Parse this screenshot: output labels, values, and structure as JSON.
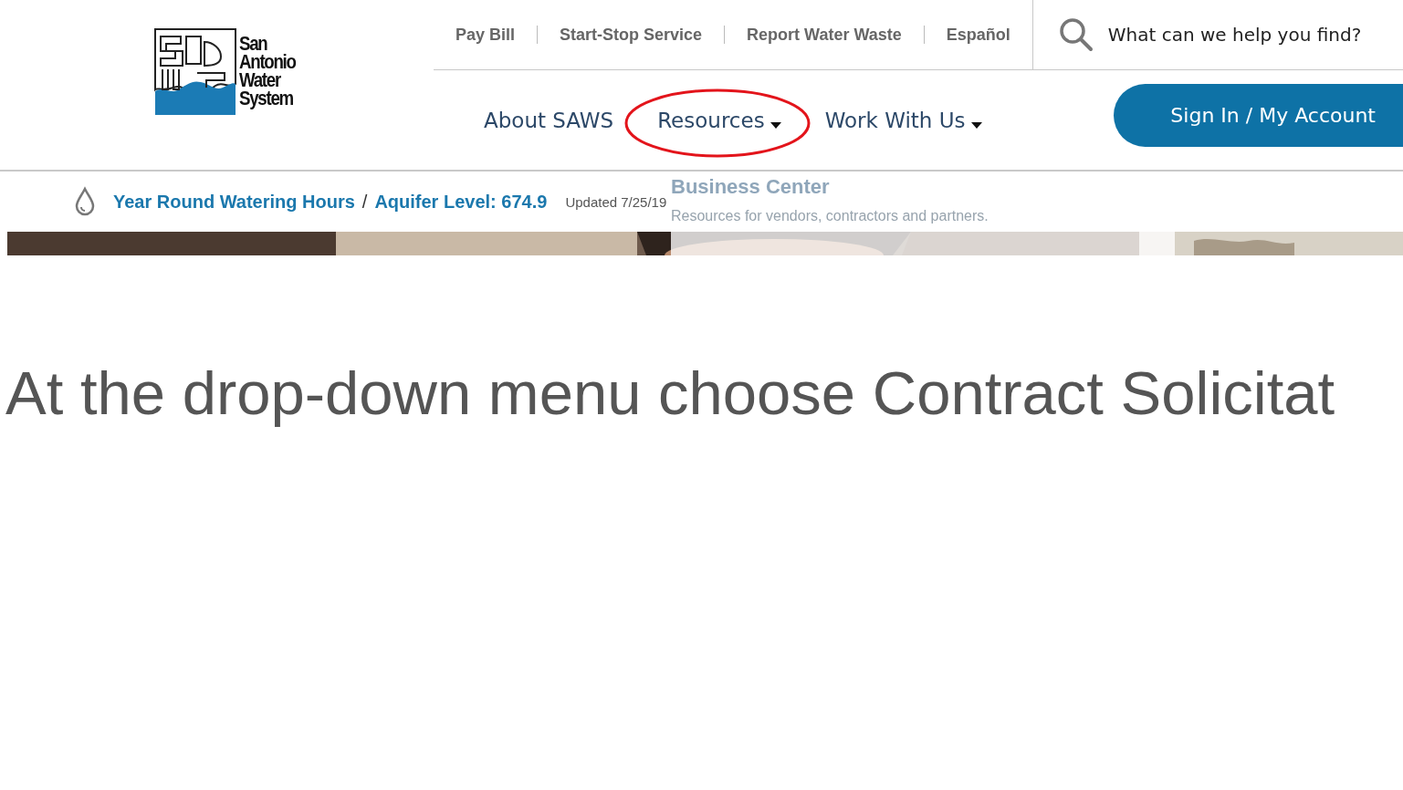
{
  "logo": {
    "lines": [
      "San",
      "Antonio",
      "Water",
      "System"
    ]
  },
  "utility_links": [
    "Pay Bill",
    "Start-Stop Service",
    "Report Water Waste",
    "Español"
  ],
  "search": {
    "placeholder": "What can we help you find?"
  },
  "main_nav": [
    {
      "label": "About SAWS",
      "has_dropdown": false,
      "highlighted": false
    },
    {
      "label": "Resources",
      "has_dropdown": true,
      "highlighted": true
    },
    {
      "label": "Work With Us",
      "has_dropdown": true,
      "highlighted": false
    }
  ],
  "account_button": "Sign In / My Account",
  "info_bar": {
    "watering_link": "Year Round Watering Hours",
    "separator": "/",
    "aquifer_link": "Aquifer Level: 674.9",
    "updated": "Updated 7/25/19"
  },
  "dropdown": {
    "items": [
      {
        "title": "Business Center",
        "description": "Resources for vendors, contractors and partners."
      }
    ]
  },
  "caption": "At the drop-down menu choose Contract Solicitat"
}
